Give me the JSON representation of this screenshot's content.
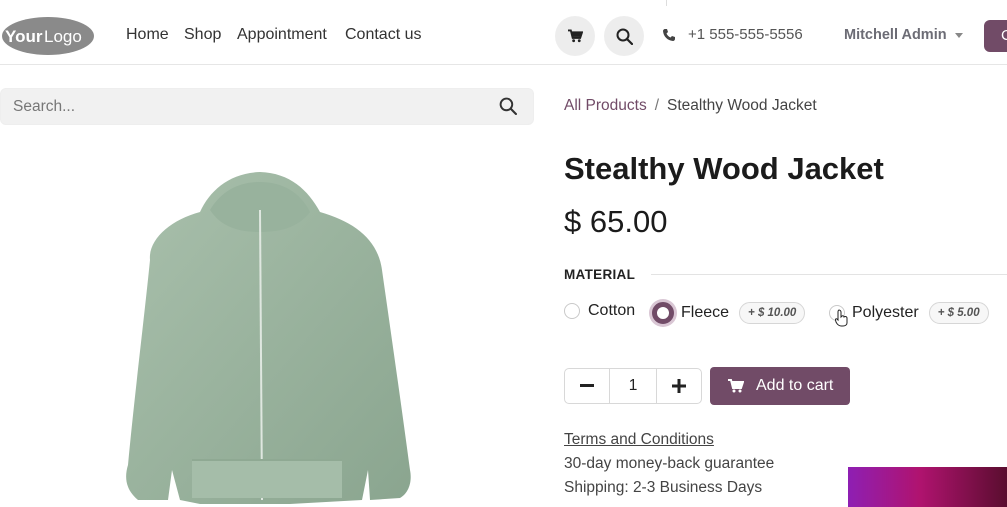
{
  "navbar": {
    "logo_text_1": "Your",
    "logo_text_2": "Logo",
    "links": [
      "Home",
      "Shop",
      "Appointment",
      "Contact us"
    ],
    "phone": "+1 555-555-5556",
    "user": "Mitchell Admin",
    "cta_label": "C"
  },
  "search": {
    "placeholder": "Search..."
  },
  "breadcrumb": {
    "parent": "All Products",
    "separator": "/",
    "current": "Stealthy Wood Jacket"
  },
  "product": {
    "name": "Stealthy Wood Jacket",
    "price": "$ 65.00",
    "attribute_label": "MATERIAL",
    "options": [
      {
        "label": "Cotton",
        "extra": "",
        "checked": false
      },
      {
        "label": "Fleece",
        "extra": "+ $ 10.00",
        "checked": true
      },
      {
        "label": "Polyester",
        "extra": "+ $ 5.00",
        "checked": false
      }
    ],
    "quantity": "1",
    "add_to_cart": "Add to cart"
  },
  "info": {
    "terms": "Terms and Conditions",
    "guarantee": "30-day money-back guarantee",
    "shipping": "Shipping: 2-3 Business Days"
  },
  "colors": {
    "brand": "#714b67",
    "jacket": "#9fb7a3"
  }
}
